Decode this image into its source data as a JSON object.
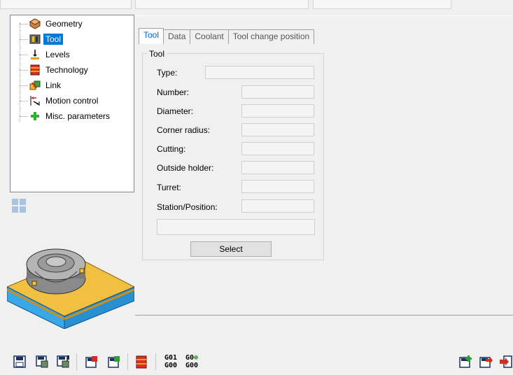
{
  "tree": {
    "items": [
      {
        "label": "Geometry",
        "icon": "geometry-icon"
      },
      {
        "label": "Tool",
        "icon": "tool-icon",
        "selected": true
      },
      {
        "label": "Levels",
        "icon": "levels-icon"
      },
      {
        "label": "Technology",
        "icon": "technology-icon"
      },
      {
        "label": "Link",
        "icon": "link-icon"
      },
      {
        "label": "Motion control",
        "icon": "motion-control-icon"
      },
      {
        "label": "Misc. parameters",
        "icon": "misc-parameters-icon"
      }
    ]
  },
  "tabs": [
    {
      "label": "Tool",
      "active": true
    },
    {
      "label": "Data"
    },
    {
      "label": "Coolant"
    },
    {
      "label": "Tool change position"
    }
  ],
  "group": {
    "title": "Tool",
    "fields": [
      {
        "label": "Type:",
        "value": ""
      },
      {
        "label": "Number:",
        "value": ""
      },
      {
        "label": "Diameter:",
        "value": ""
      },
      {
        "label": "Corner radius:",
        "value": ""
      },
      {
        "label": "Cutting:",
        "value": ""
      },
      {
        "label": "Outside holder:",
        "value": ""
      },
      {
        "label": "Turret:",
        "value": ""
      },
      {
        "label": "Station/Position:",
        "value": ""
      }
    ],
    "description_value": "",
    "select_label": "Select"
  },
  "toolbar": {
    "gcode1_top": "G01",
    "gcode1_bottom": "G00",
    "gcode2_top": "G0",
    "gcode2_bottom": "G00"
  },
  "colors": {
    "selection": "#0078d7",
    "tab_active": "#0066cc"
  }
}
